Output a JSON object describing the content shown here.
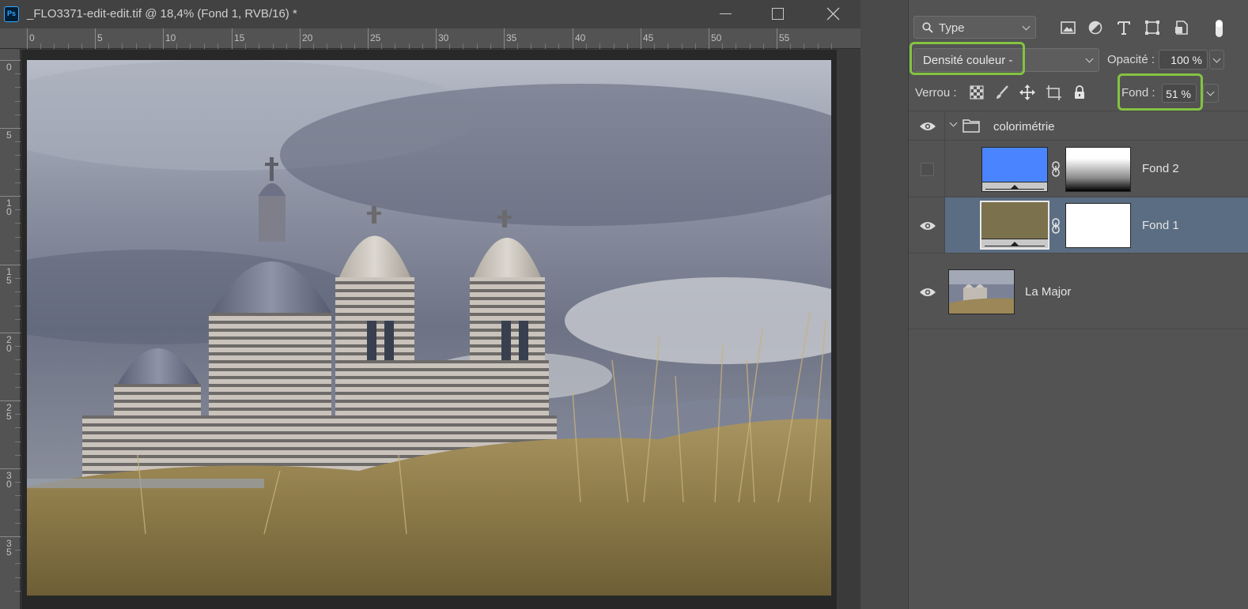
{
  "app": {
    "logo_text": "Ps"
  },
  "document": {
    "title": "_FLO3371-edit-edit.tif @ 18,4% (Fond 1, RVB/16) *",
    "ruler_top_labels": [
      "0",
      "5",
      "10",
      "15",
      "20",
      "25",
      "30",
      "35",
      "40",
      "45",
      "50",
      "55"
    ],
    "ruler_left_labels": [
      "0",
      "5",
      "10",
      "15",
      "20",
      "25",
      "30",
      "35"
    ]
  },
  "layers_panel": {
    "filter": {
      "label": "Type",
      "icons": [
        "image-filter-icon",
        "adjustment-filter-icon",
        "type-filter-icon",
        "shape-filter-icon",
        "smart-object-filter-icon",
        "filter-toggle-icon"
      ]
    },
    "blend_mode": "Densité couleur -",
    "opacity_label": "Opacité :",
    "opacity_value": "100 %",
    "lock_label": "Verrou :",
    "lock_icons": [
      "lock-transparent-pixels-icon",
      "lock-image-pixels-icon",
      "lock-position-icon",
      "lock-artboard-icon",
      "lock-all-icon"
    ],
    "fill_label": "Fond :",
    "fill_value": "51 %",
    "highlight_color": "#84c341",
    "layers": [
      {
        "name": "colorimétrie",
        "type": "group",
        "visible": true,
        "expanded": true
      },
      {
        "name": "Fond 2",
        "type": "fill",
        "visible": false,
        "swatch": "#4a85ff",
        "mask": "gradient"
      },
      {
        "name": "Fond 1",
        "type": "fill",
        "visible": true,
        "selected": true,
        "swatch": "#7b714c",
        "mask": "white"
      },
      {
        "name": "La Major",
        "type": "image",
        "visible": true
      }
    ]
  }
}
